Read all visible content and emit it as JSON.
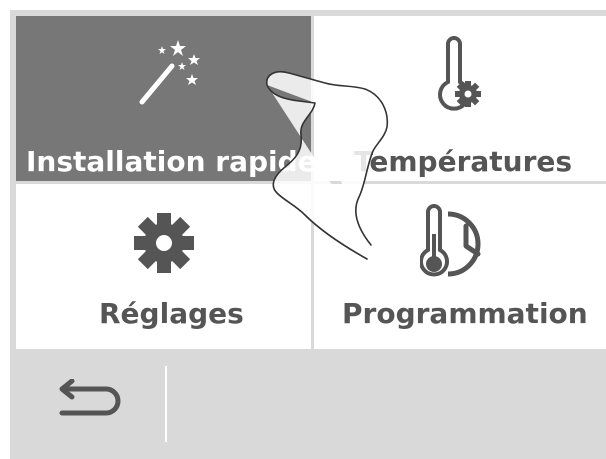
{
  "menu": {
    "tiles": [
      {
        "label": "Installation rapide",
        "icon": "magic-wand-icon",
        "active": true
      },
      {
        "label": "Températures",
        "icon": "thermometer-gear-icon",
        "active": false
      },
      {
        "label": "Réglages",
        "icon": "gear-icon",
        "active": false
      },
      {
        "label": "Programmation",
        "icon": "thermometer-clock-icon",
        "active": false
      }
    ]
  },
  "bottom_bar": {
    "back_icon": "back-arrow-icon"
  },
  "colors": {
    "active_tile": "#777777",
    "tile": "#ffffff",
    "frame": "#d9d9d9",
    "icon": "#555555",
    "label": "#555555"
  }
}
